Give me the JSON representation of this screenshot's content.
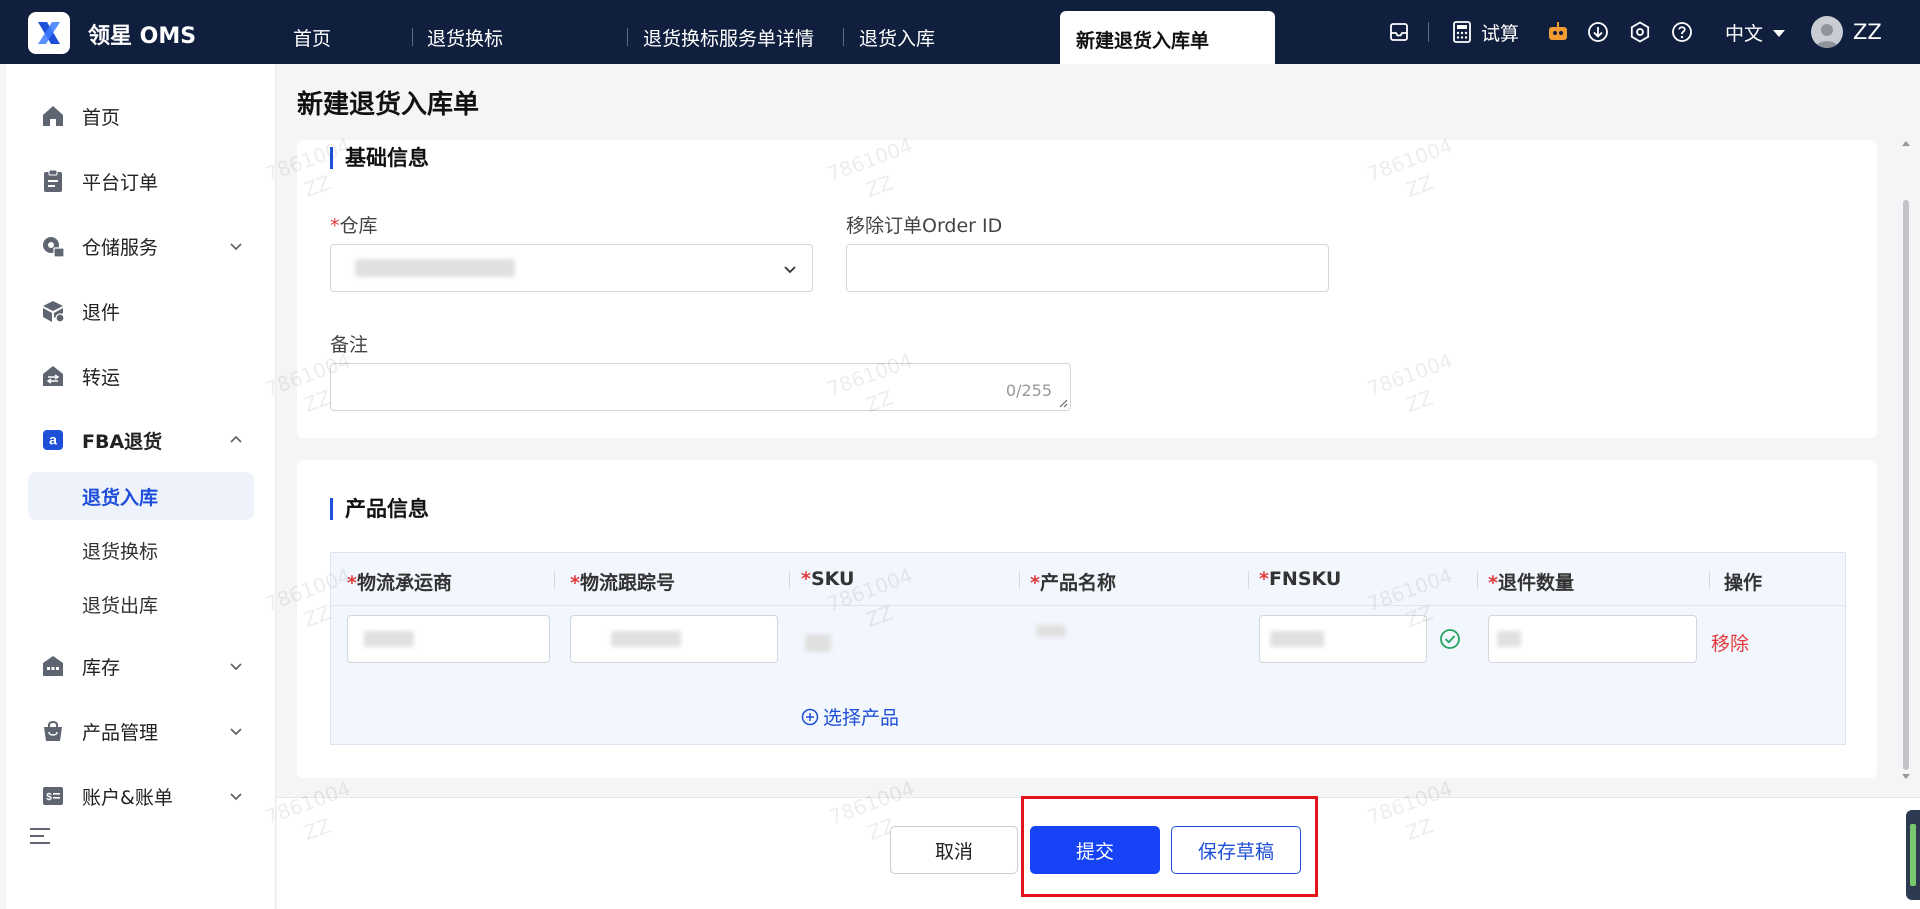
{
  "app": {
    "brand": "领星 OMS"
  },
  "tabs": [
    {
      "label": "首页"
    },
    {
      "label": "退货换标"
    },
    {
      "label": "退货换标服务单详情"
    },
    {
      "label": "退货入库"
    },
    {
      "label": "新建退货入库单"
    }
  ],
  "topbar": {
    "trial": "试算",
    "language": "中文",
    "user": "ZZ"
  },
  "sidebar": {
    "items": [
      {
        "label": "首页",
        "icon": "home-icon"
      },
      {
        "label": "平台订单",
        "icon": "clipboard-icon"
      },
      {
        "label": "仓储服务",
        "icon": "warehouse-service-icon"
      },
      {
        "label": "退件",
        "icon": "return-box-icon"
      },
      {
        "label": "转运",
        "icon": "transfer-icon"
      },
      {
        "label": "FBA退货",
        "icon": "amazon-icon"
      },
      {
        "label": "库存",
        "icon": "inventory-icon"
      },
      {
        "label": "产品管理",
        "icon": "bag-icon"
      },
      {
        "label": "账户&账单",
        "icon": "bill-icon"
      }
    ],
    "fba_sub": [
      {
        "label": "退货入库"
      },
      {
        "label": "退货换标"
      },
      {
        "label": "退货出库"
      }
    ]
  },
  "page": {
    "title": "新建退货入库单"
  },
  "basic": {
    "title": "基础信息",
    "warehouse_label": "仓库",
    "order_id_label": "移除订单Order ID",
    "remark_label": "备注",
    "remark_counter": "0/255"
  },
  "product": {
    "title": "产品信息",
    "columns": [
      "物流承运商",
      "物流跟踪号",
      "SKU",
      "产品名称",
      "FNSKU",
      "退件数量",
      "操作"
    ],
    "remove_label": "移除",
    "select_product": "选择产品"
  },
  "footer": {
    "cancel": "取消",
    "submit": "提交",
    "save_draft": "保存草稿"
  },
  "watermark": {
    "line1": "7861004",
    "line2": "ZZ"
  },
  "colors": {
    "accent": "#1d4fd8",
    "topbar": "#0f1f3d",
    "primary_button": "#1543f5",
    "danger": "#e23b3b",
    "highlight": "#e3141b"
  }
}
